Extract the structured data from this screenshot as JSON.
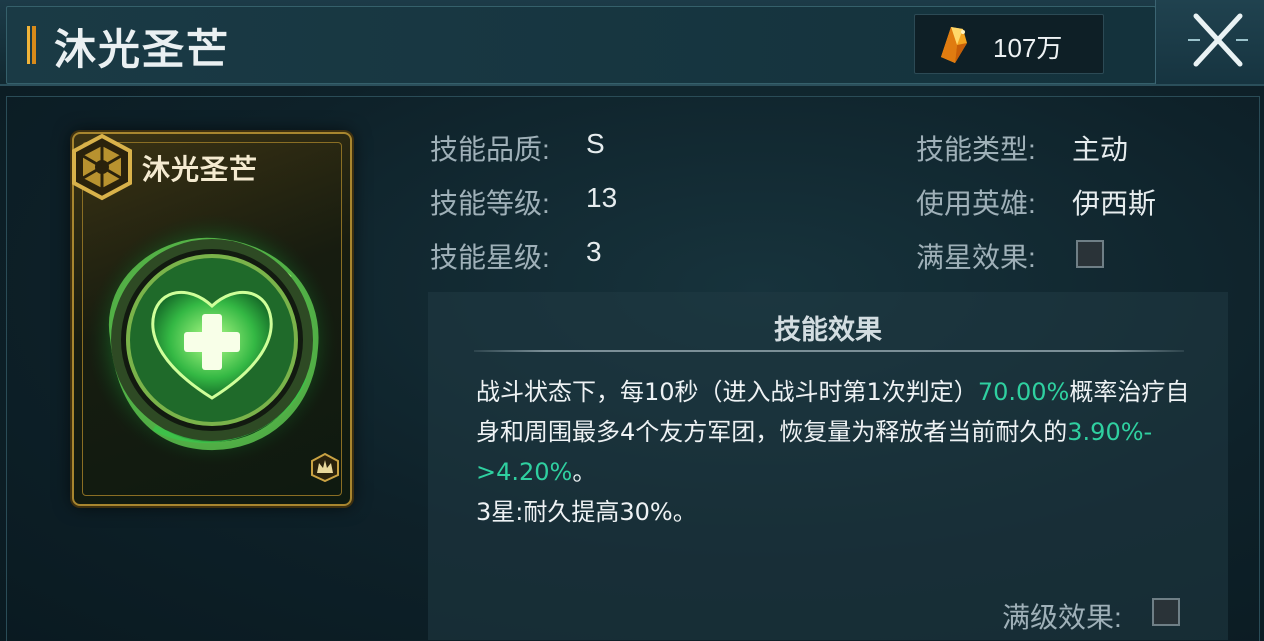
{
  "header": {
    "title": "沐光圣芒",
    "currency": {
      "icon": "crystal-icon",
      "amount": "107万"
    },
    "close_icon": "close-crossed-swords-icon"
  },
  "card": {
    "name": "沐光圣芒",
    "emblem_icon": "hex-emblem-icon",
    "art_icon": "green-heart-heal-icon",
    "badge_icon": "crown-badge-icon",
    "accent_color": "#a8862f"
  },
  "info": {
    "quality_label": "技能品质:",
    "quality_value": "S",
    "level_label": "技能等级:",
    "level_value": "13",
    "star_label": "技能星级:",
    "star_value": "3",
    "type_label": "技能类型:",
    "type_value": "主动",
    "hero_label": "使用英雄:",
    "hero_value": "伊西斯",
    "fullstar_label": "满星效果:",
    "fullstar_checked": false
  },
  "effect": {
    "title": "技能效果",
    "line1_pre": "战斗状态下，每10秒（进入战斗时第1次判定）",
    "line1_hl": "70.00%",
    "line1_post": "概率治疗自身和周围最多4个友方军团，恢复量为释放者当前耐久的",
    "line1_hl2": "3.90%->4.20%",
    "line1_end": "。",
    "line2": "3星:耐久提高30%。",
    "highlight_color": "#2fd0a0",
    "maxlvl_label": "满级效果:",
    "maxlvl_checked": false
  }
}
